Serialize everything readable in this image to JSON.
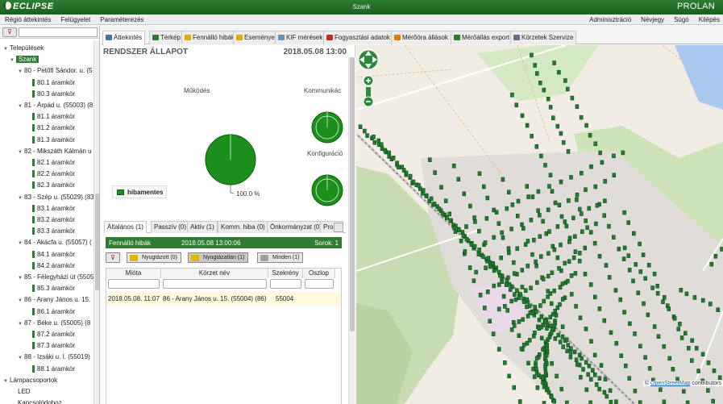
{
  "titlebar": {
    "logo": "ECLIPSE",
    "title": "Szank",
    "brand": "PROLAN"
  },
  "menu": {
    "left": [
      "Régió áttekintés",
      "Felügyelet",
      "Paraméterezés"
    ],
    "right": [
      "Adminisztráció",
      "Névjegy",
      "Súgó",
      "Kilépés"
    ]
  },
  "tree": {
    "root": "Települések",
    "selected": "Szank",
    "groups": [
      {
        "label": "80 - Petőfi Sándor. u. (5",
        "children": [
          "80.1 áramkör",
          "80.3 áramkör"
        ]
      },
      {
        "label": "81 - Árpád u. (55003) (8",
        "children": [
          "81.1 áramkör",
          "81.2 áramkör",
          "81.3 áramkör"
        ]
      },
      {
        "label": "82 - Mikszáth Kálmán u",
        "children": [
          "82.1 áramkör",
          "82.2 áramkör",
          "82.3 áramkör"
        ]
      },
      {
        "label": "83 - Szép u. (55029) (83",
        "children": [
          "83.1 áramkör",
          "83.2 áramkör",
          "83.3 áramkör"
        ]
      },
      {
        "label": "84 - Akácfa u. (55057) (",
        "children": [
          "84.1 áramkör",
          "84.2 áramkör"
        ]
      },
      {
        "label": "85 - Félegyházi út (5505",
        "children": [
          "85.3 áramkör"
        ]
      },
      {
        "label": "86 - Arany János u. 15.",
        "children": [
          "86.1 áramkör"
        ]
      },
      {
        "label": "87 - Béke u. (55005) (8",
        "children": [
          "87.2 áramkör",
          "87.3 áramkör"
        ]
      },
      {
        "label": "88 - Izsáki u. I. (55019)",
        "children": [
          "88.1 áramkör"
        ]
      }
    ],
    "lamp_group": "Lámpacsoportok",
    "lamp_children": [
      "LED",
      "Kapcsolódoboz"
    ]
  },
  "tabs": [
    {
      "label": "Áttekintés",
      "icon": "eye-icon",
      "color": "#4a6fa5"
    },
    {
      "label": "Térkép",
      "icon": "globe-icon",
      "color": "#2e7d32"
    },
    {
      "label": "Fennálló hibák",
      "icon": "warning-list-icon",
      "color": "#e0a800"
    },
    {
      "label": "Események",
      "icon": "events-icon",
      "color": "#e0a800"
    },
    {
      "label": "KIF mérések",
      "icon": "measure-icon",
      "color": "#6a8fb5"
    },
    {
      "label": "Fogyasztási adatok",
      "icon": "bar-chart-icon",
      "color": "#c62828"
    },
    {
      "label": "Mérőóra állások",
      "icon": "meter-icon",
      "color": "#e07b00"
    },
    {
      "label": "Mérőállás export",
      "icon": "export-icon",
      "color": "#2e7d32"
    },
    {
      "label": "Körzetek Szervize",
      "icon": "wrench-icon",
      "color": "#6a6a8a"
    }
  ],
  "status": {
    "title": "RENDSZER ÁLLAPOT",
    "datetime": "2018.05.08 13:00",
    "charts": [
      {
        "label": "Működés",
        "legend": "hibamentes",
        "value_text": "100.0 %",
        "percent": 100
      },
      {
        "label": "Kommunikác",
        "percent": 100
      },
      {
        "label": "Konfiguráció",
        "percent": 100
      }
    ],
    "colors": {
      "ok": "#1b8e1b",
      "ok_dark": "#0b5e0b"
    }
  },
  "subtabs": [
    "Általános (1)",
    "Passzív (0)",
    "Aktív (1)",
    "Komm. hiba (0)",
    "Önkormányzat (0)",
    "Proak"
  ],
  "faults": {
    "title": "Fennálló hibák",
    "datetime": "2018.05.08 13:00:06",
    "rows_label": "Sorok: 1",
    "buttons": {
      "acknowledged": "Nyugtázott (0)",
      "unacknowledged": "Nyugtázatlan (1)",
      "all": "Minden (1)"
    },
    "columns": [
      "Mióta",
      "Körzet név",
      "Szekrény",
      "Oszlop"
    ],
    "rows": [
      {
        "since": "2018.05.08. 11:07",
        "district": "86 - Arany János u. 15. (55004) (86)",
        "cabinet": "55004",
        "column": ""
      }
    ]
  },
  "map": {
    "attribution_prefix": "©",
    "attribution_link": "OpenStreetMap",
    "attribution_suffix": "contributors"
  }
}
